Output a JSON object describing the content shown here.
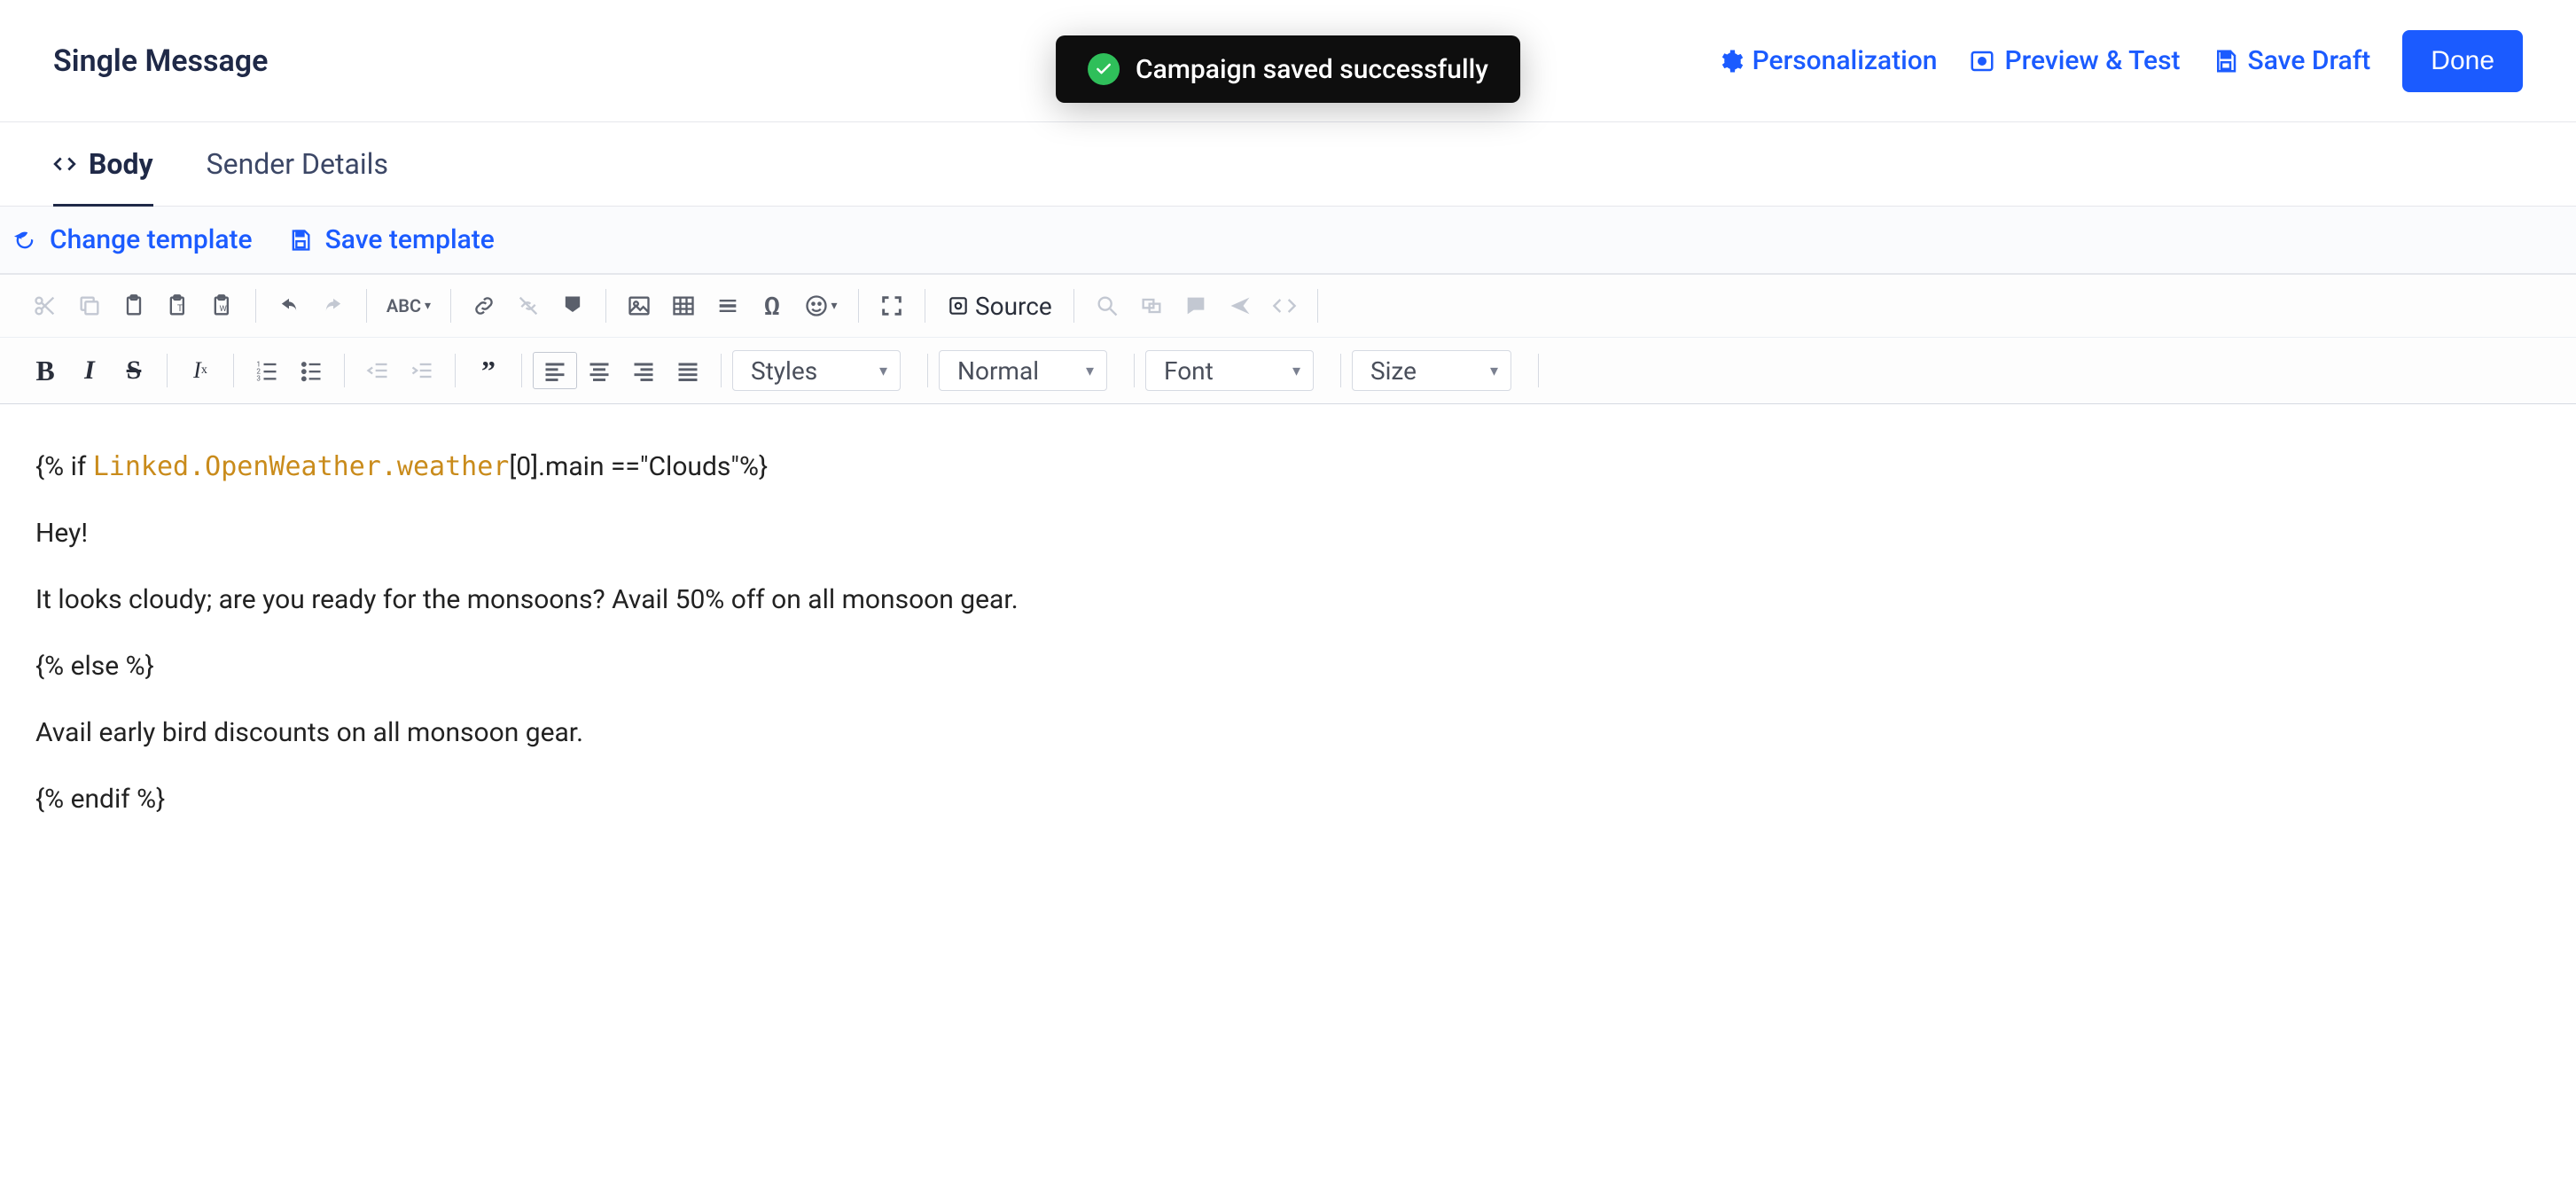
{
  "header": {
    "title": "Single Message",
    "toast": "Campaign saved successfully",
    "actions": {
      "personalization": "Personalization",
      "preview_test": "Preview & Test",
      "save_draft": "Save Draft",
      "done": "Done"
    }
  },
  "tabs": {
    "body": "Body",
    "sender_details": "Sender Details"
  },
  "template_bar": {
    "change": "Change template",
    "save": "Save template"
  },
  "toolbar": {
    "source_label": "Source",
    "dropdowns": {
      "styles": "Styles",
      "format": "Normal",
      "font": "Font",
      "size": "Size"
    }
  },
  "editor": {
    "line_if_open": "{% if ",
    "line_if_var": "Linked.OpenWeather.weather",
    "line_if_close": "[0].main ==\"Clouds\"%}",
    "greeting": "Hey!",
    "cloudy_msg": "It looks cloudy; are you ready for the monsoons? Avail 50% off on all monsoon gear.",
    "else_tag": "{% else %}",
    "else_msg": "Avail early bird discounts on all monsoon gear.",
    "endif_tag": "{% endif %}"
  }
}
